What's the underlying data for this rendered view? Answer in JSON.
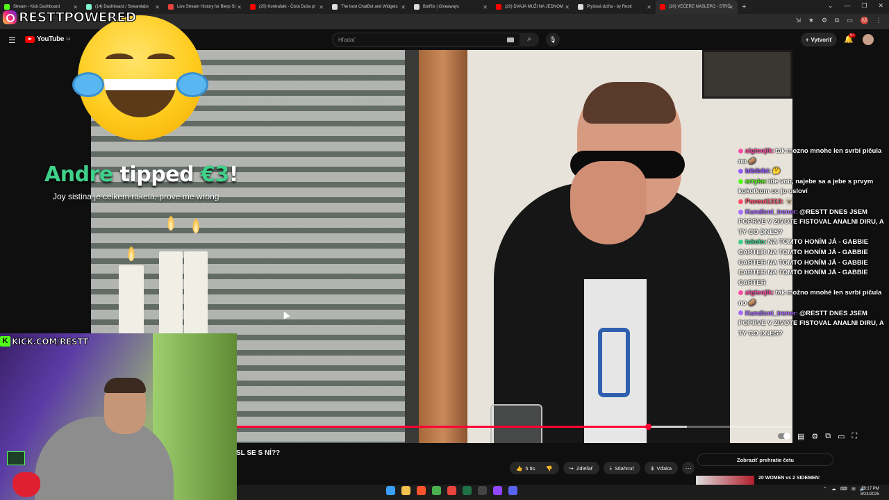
{
  "browser": {
    "tabs": [
      {
        "label": "Stream - Kick Dashboard",
        "color": "#53fc18"
      },
      {
        "label": "(14) Dashboard / Streamlabs",
        "color": "#80f5d2"
      },
      {
        "label": "Live Stream History for Blerp St",
        "color": "#e8433d"
      },
      {
        "label": "(20) Kontrafakt - Čistá Duša pr",
        "color": "#ff0000"
      },
      {
        "label": "The best ChatBot and Widgets",
        "color": "#dddddd"
      },
      {
        "label": "BotRix | Giveaways",
        "color": "#dddddd"
      },
      {
        "label": "(20) DVAJA MUŽI NA JEDNOM",
        "color": "#ff0000"
      },
      {
        "label": "Plyšová dzíňa - by Restt",
        "color": "#dddddd"
      },
      {
        "label": "(20) VEČERE NASLEPO - STRČ",
        "color": "#ff0000",
        "active": true
      }
    ],
    "new_tab": "+",
    "window_controls": [
      "⌄",
      "—",
      "❐",
      "✕"
    ],
    "toolbar_icons": [
      "⇲",
      "★",
      "⚙",
      "⧉",
      "▭",
      "M",
      "⋮"
    ]
  },
  "youtube": {
    "logo_text": "YouTube",
    "logo_region": "SK",
    "search_placeholder": "Hľadať",
    "create_label": "Vytvoriť",
    "notifications_badge": "9+",
    "video_title_fragment": "SL SE S NÍ??",
    "actions": {
      "likes": "5 tis.",
      "share": "Zdieľať",
      "download": "Stiahnuť",
      "thanks": "Vďaka",
      "more": "⋯"
    },
    "replay_chat_label": "Zobraziť prehratie četu",
    "recommended_title": "20 WOMEN vs 2 SIDEMEN:",
    "progress": {
      "played_fraction": 0.74,
      "buffered_fraction": 0.81
    }
  },
  "overlay": {
    "brand_name": "RESTTPOWERED",
    "tip": {
      "user": "Andre",
      "verb": "tipped",
      "amount": "€3",
      "exclaim": "!"
    },
    "tip_message": "Joy sistina je celkem raketa, prove me wrong",
    "kick_url": "KICK.COM/RESTT",
    "kick_letter": "K"
  },
  "chat": [
    {
      "user": "aigtsojik:",
      "text": "tak mozno mnohe len svrbi pičula no 🥔",
      "color": "#ff4da6"
    },
    {
      "user": "bibibibi:",
      "text": "🤔",
      "color": "#9b5cff"
    },
    {
      "user": "erryke:",
      "text": "ide von, najebe sa a jebe s prvym kokotkom co ju osloví",
      "color": "#53fc18"
    },
    {
      "user": "Paveut1313:",
      "text": "🫥",
      "color": "#ff4d6d"
    },
    {
      "user": "Kundicni_trener:",
      "text": "@RESTT DNES JSEM POPRVE V ZIVOTE FISTOVAL ANALNI DIRU, A TY CO DNES?",
      "color": "#a86bff"
    },
    {
      "user": "takelo:",
      "text": "NA TOMTO HONÍM JÁ - GABBIE CARTER NA TOMTO HONÍM JÁ - GABBIE CARTER NA TOMTO HONÍM JÁ - GABBIE CARTER NA TOMTO HONÍM JÁ - GABBIE CARTER",
      "color": "#3fd08a"
    },
    {
      "user": "aigtsojik:",
      "text": "tak možno mnohé len svrbí pičula no 🥔",
      "color": "#ff4da6"
    },
    {
      "user": "Kundicni_trener:",
      "text": "@RESTT DNES JSEM POPRVE V ZIVOTE FISTOVAL ANALNI DIRU, A TY CO DNES?",
      "color": "#a86bff"
    }
  ],
  "taskbar": {
    "time": "13:17 PM",
    "date": "8/24/2025",
    "tray": [
      "⌃",
      "☁",
      "⌨",
      "⊞",
      "🔊"
    ],
    "apps": [
      {
        "name": "windows",
        "color": "#3aa0ff"
      },
      {
        "name": "files",
        "color": "#f2c14e"
      },
      {
        "name": "brave",
        "color": "#fb542b"
      },
      {
        "name": "chrome",
        "color": "#4caf50"
      },
      {
        "name": "app-red",
        "color": "#e8433d"
      },
      {
        "name": "excel",
        "color": "#1e7145"
      },
      {
        "name": "obs",
        "color": "#444444"
      },
      {
        "name": "twitch",
        "color": "#9146ff"
      },
      {
        "name": "discord",
        "color": "#5865f2"
      }
    ]
  }
}
